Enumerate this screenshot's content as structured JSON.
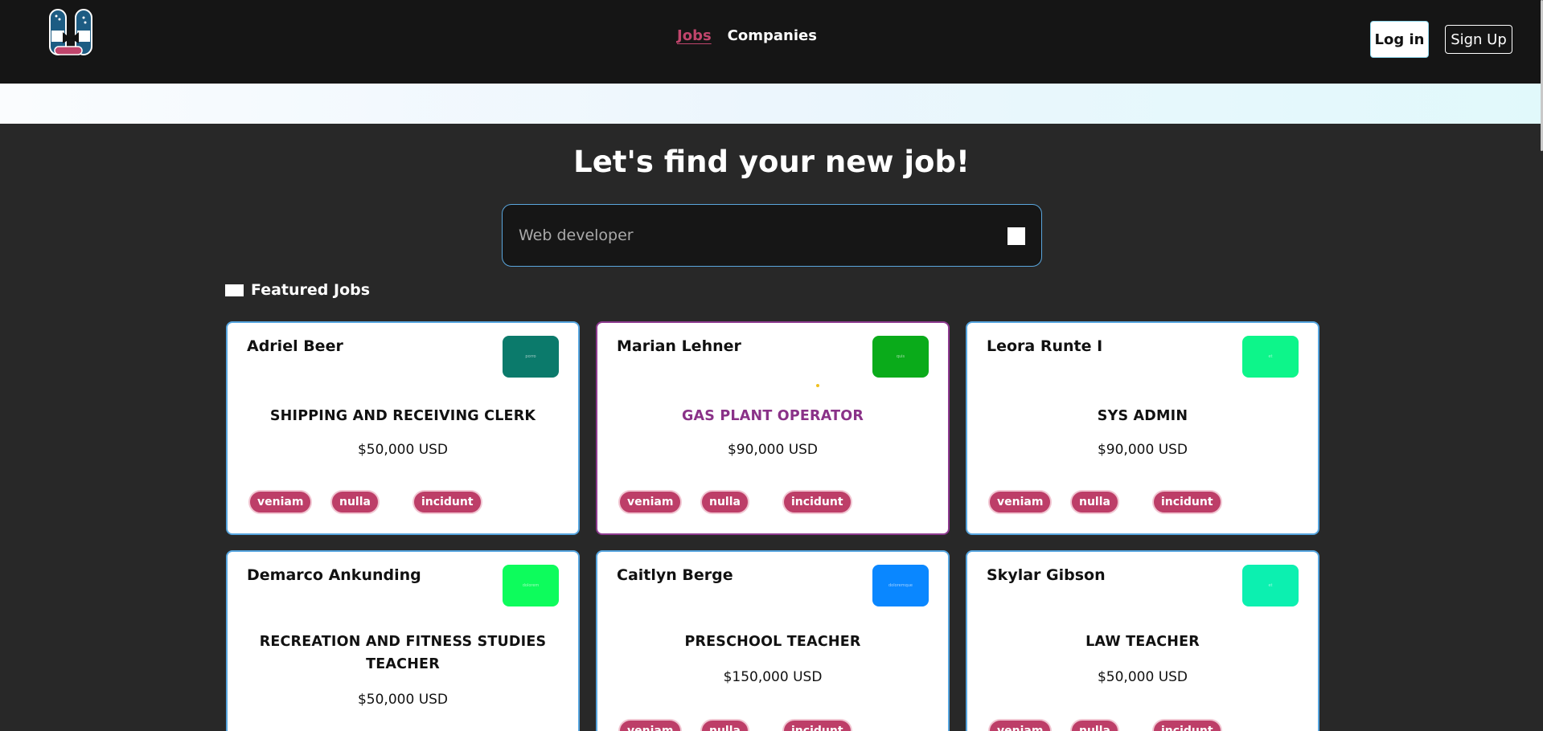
{
  "nav": {
    "links": [
      {
        "label": "Jobs",
        "active": true
      },
      {
        "label": "Companies",
        "active": false
      }
    ],
    "login_label": "Log in",
    "signup_label": "Sign Up"
  },
  "hero": {
    "title": "Let's find your new job!",
    "search_placeholder": "Web developer"
  },
  "featured": {
    "title": "Featured Jobs"
  },
  "cards": [
    {
      "company": "Adriel Beer",
      "logo_text": "porro",
      "logo_color": "#0b7a6b",
      "title": "SHIPPING AND RECEIVING CLERK",
      "salary": "$50,000 USD",
      "tags": [
        "veniam",
        "nulla",
        "incidunt"
      ],
      "highlight": false
    },
    {
      "company": "Marian Lehner",
      "logo_text": "quis",
      "logo_color": "#0aab1a",
      "title": "GAS PLANT OPERATOR",
      "salary": "$90,000 USD",
      "tags": [
        "veniam",
        "nulla",
        "incidunt"
      ],
      "highlight": true
    },
    {
      "company": "Leora Runte I",
      "logo_text": "et",
      "logo_color": "#0df58a",
      "title": "SYS ADMIN",
      "salary": "$90,000 USD",
      "tags": [
        "veniam",
        "nulla",
        "incidunt"
      ],
      "highlight": false
    },
    {
      "company": "Demarco Ankunding",
      "logo_text": "dolorem",
      "logo_color": "#0dfc5c",
      "title": "RECREATION AND FITNESS STUDIES TEACHER",
      "salary": "$50,000 USD",
      "tags": [
        "veniam",
        "nulla",
        "incidunt"
      ],
      "highlight": false
    },
    {
      "company": "Caitlyn Berge",
      "logo_text": "doloremque",
      "logo_color": "#0a87ff",
      "title": "PRESCHOOL TEACHER",
      "salary": "$150,000 USD",
      "tags": [
        "veniam",
        "nulla",
        "incidunt"
      ],
      "highlight": false
    },
    {
      "company": "Skylar Gibson",
      "logo_text": "et",
      "logo_color": "#0cf0b0",
      "title": "LAW TEACHER",
      "salary": "$50,000 USD",
      "tags": [
        "veniam",
        "nulla",
        "incidunt"
      ],
      "highlight": false
    }
  ]
}
